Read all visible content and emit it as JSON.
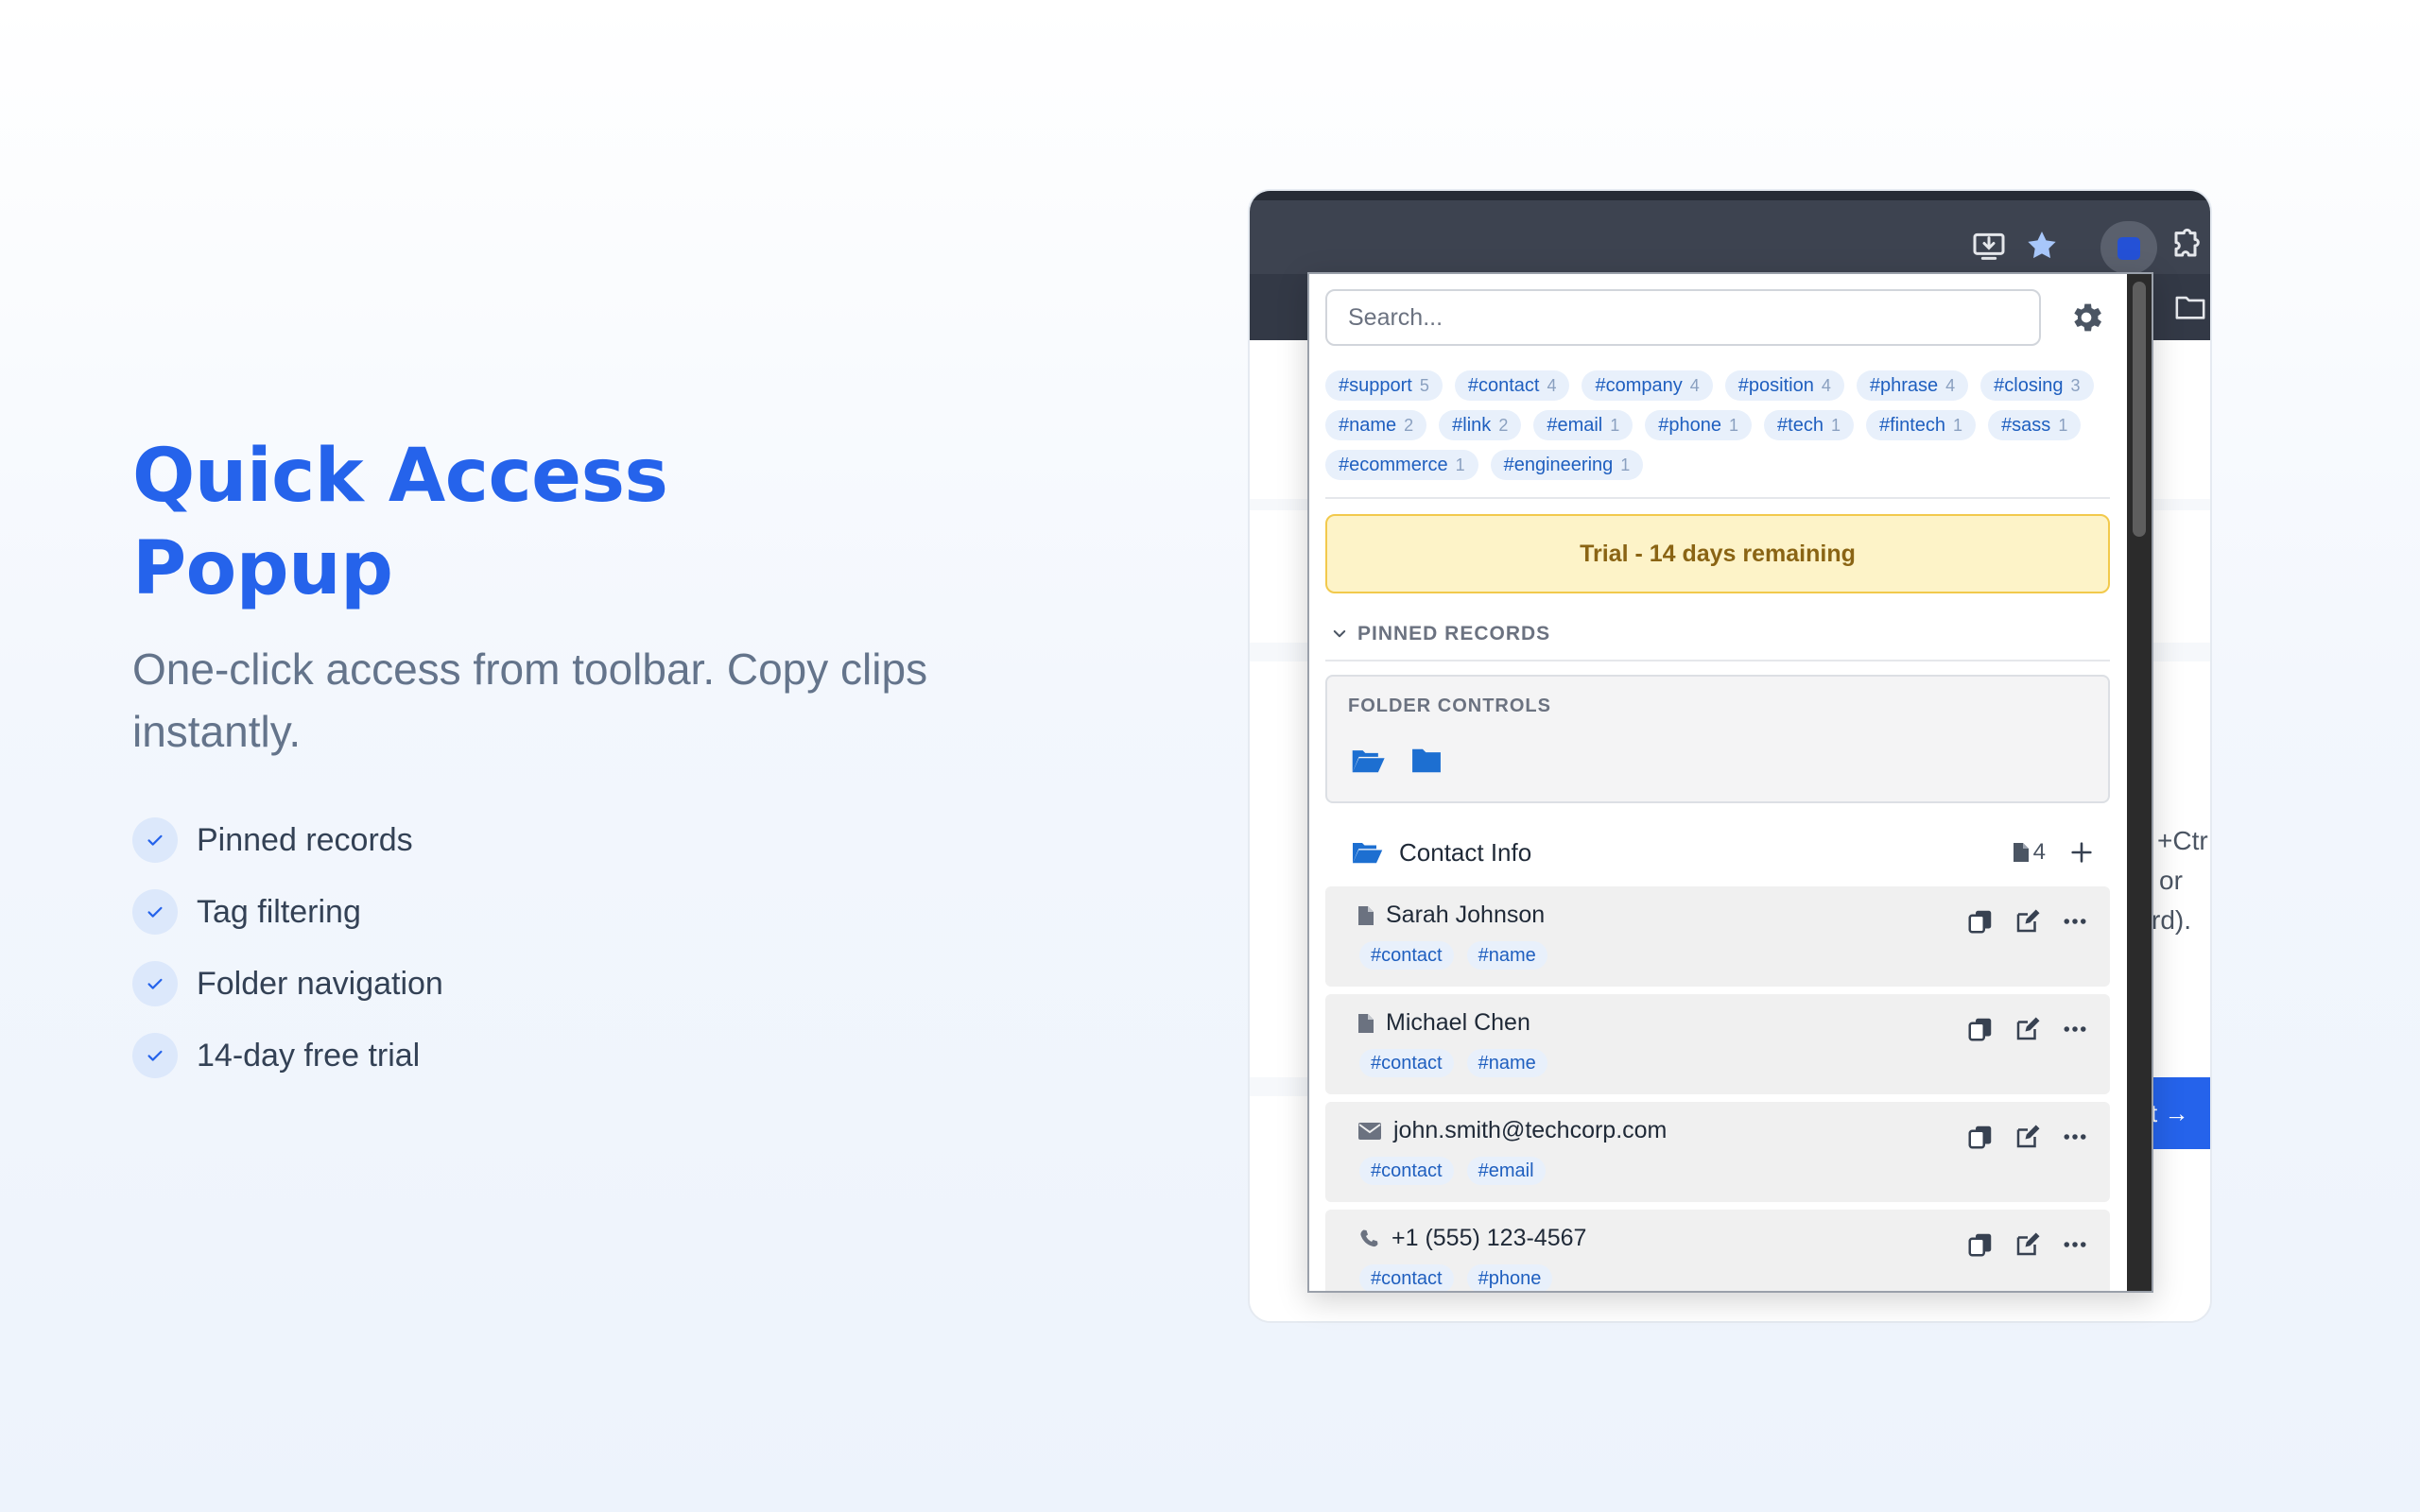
{
  "hero": {
    "title_line1": "Quick Access",
    "title_line2": "Popup",
    "subtitle": "One-click access from toolbar. Copy clips instantly.",
    "features": [
      "Pinned records",
      "Tag filtering",
      "Folder navigation",
      "14-day free trial"
    ]
  },
  "browser": {
    "toolbar_icons": [
      "install-icon",
      "star-icon",
      "extension-active-icon",
      "puzzle-icon"
    ],
    "page_fragments": [
      "+Ctr",
      "or",
      "rd).",
      "xt →"
    ]
  },
  "popup": {
    "search": {
      "placeholder": "Search...",
      "value": ""
    },
    "tags": [
      {
        "label": "#support",
        "count": "5"
      },
      {
        "label": "#contact",
        "count": "4"
      },
      {
        "label": "#company",
        "count": "4"
      },
      {
        "label": "#position",
        "count": "4"
      },
      {
        "label": "#phrase",
        "count": "4"
      },
      {
        "label": "#closing",
        "count": "3"
      },
      {
        "label": "#name",
        "count": "2"
      },
      {
        "label": "#link",
        "count": "2"
      },
      {
        "label": "#email",
        "count": "1"
      },
      {
        "label": "#phone",
        "count": "1"
      },
      {
        "label": "#tech",
        "count": "1"
      },
      {
        "label": "#fintech",
        "count": "1"
      },
      {
        "label": "#sass",
        "count": "1"
      },
      {
        "label": "#ecommerce",
        "count": "1"
      },
      {
        "label": "#engineering",
        "count": "1"
      }
    ],
    "trial_banner": "Trial - 14 days remaining",
    "pinned_header": "PINNED RECORDS",
    "folder_controls_label": "FOLDER CONTROLS",
    "folder": {
      "name": "Contact Info",
      "count": "4"
    },
    "records": [
      {
        "icon": "document-icon",
        "title": "Sarah Johnson",
        "tags": [
          "#contact",
          "#name"
        ]
      },
      {
        "icon": "document-icon",
        "title": "Michael Chen",
        "tags": [
          "#contact",
          "#name"
        ]
      },
      {
        "icon": "envelope-icon",
        "title": "john.smith@techcorp.com",
        "tags": [
          "#contact",
          "#email"
        ]
      },
      {
        "icon": "phone-icon",
        "title": "+1 (555) 123-4567",
        "tags": [
          "#contact",
          "#phone"
        ]
      }
    ]
  },
  "colors": {
    "accent": "#2563eb",
    "tag_bg": "#e8f0fb",
    "tag_text": "#1f5fbf",
    "trial_bg": "#fdf3c8",
    "trial_border": "#f2c94c",
    "folder_blue": "#1d6fd1"
  }
}
